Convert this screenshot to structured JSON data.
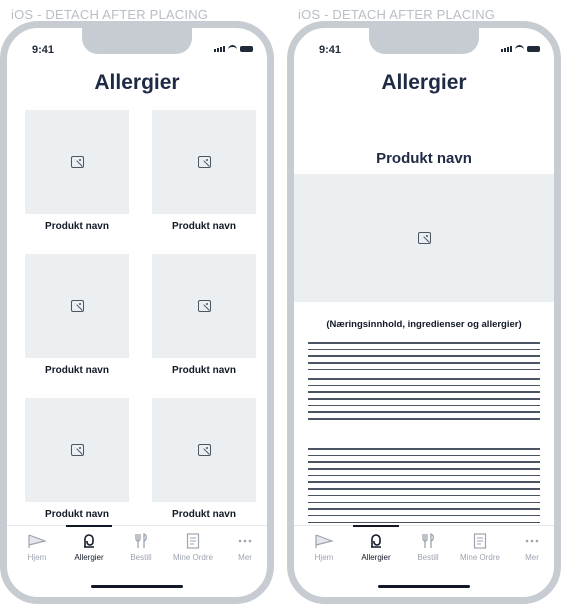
{
  "frame_label": "iOS - DETACH AFTER PLACING",
  "status": {
    "time": "9:41"
  },
  "left_screen": {
    "title": "Allergier",
    "products": [
      {
        "label": "Produkt navn"
      },
      {
        "label": "Produkt navn"
      },
      {
        "label": "Produkt navn"
      },
      {
        "label": "Produkt navn"
      },
      {
        "label": "Produkt navn"
      },
      {
        "label": "Produkt navn"
      }
    ]
  },
  "right_screen": {
    "title": "Allergier",
    "product_name": "Produkt navn",
    "info_heading": "(Næringsinnhold, ingredienser og allergier)"
  },
  "tabs": [
    {
      "label": "Hjem",
      "icon": "flag-icon"
    },
    {
      "label": "Allergier",
      "icon": "allergy-icon",
      "active": true
    },
    {
      "label": "Bestill",
      "icon": "cutlery-icon"
    },
    {
      "label": "Mine Ordre",
      "icon": "receipt-icon"
    },
    {
      "label": "Mer",
      "icon": "more-icon"
    }
  ],
  "colors": {
    "frame": "#c7ccd3",
    "placeholder": "#eceff2",
    "title": "#1f2a44"
  }
}
